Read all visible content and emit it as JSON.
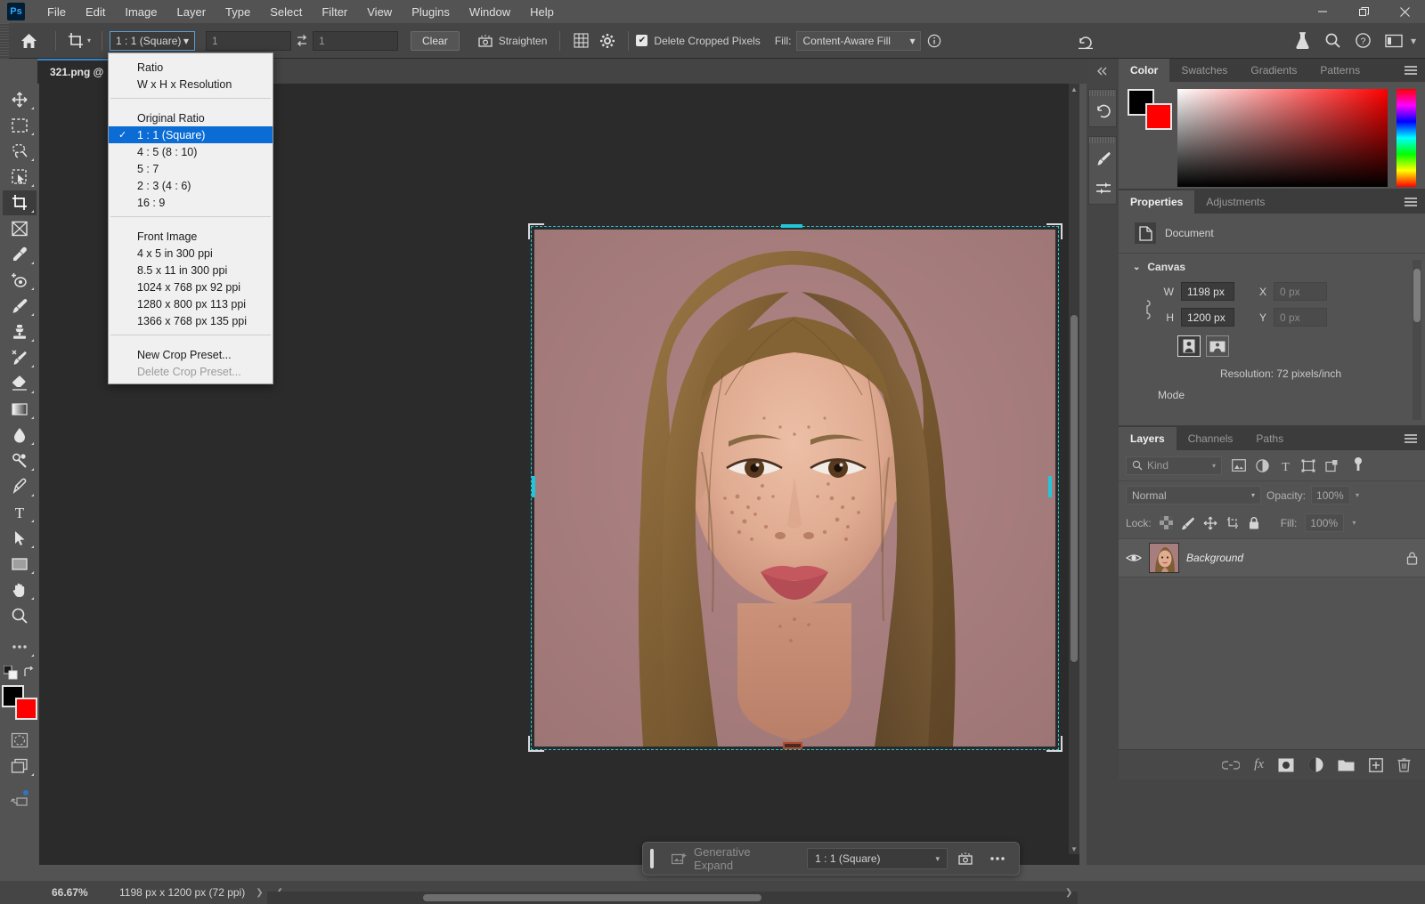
{
  "app": {
    "logo": "Ps",
    "title": "Adobe Photoshop"
  },
  "menubar": {
    "items": [
      "File",
      "Edit",
      "Image",
      "Layer",
      "Type",
      "Select",
      "Filter",
      "View",
      "Plugins",
      "Window",
      "Help"
    ]
  },
  "window_controls": {
    "minimize": "—",
    "maximize": "❐",
    "close": "✕"
  },
  "options_bar": {
    "home_icon": "home-icon",
    "tool_icon": "crop-tool-icon",
    "ratio_value": "1 : 1 (Square)",
    "width_value": "1",
    "height_value": "1",
    "swap_icon": "swap-width-height-icon",
    "clear_label": "Clear",
    "straighten_icon": "straighten-icon",
    "straighten_label": "Straighten",
    "overlay_icon": "grid-overlay-icon",
    "settings_icon": "gear-icon",
    "delete_cropped_label": "Delete Cropped Pixels",
    "delete_cropped_checked": true,
    "fill_label": "Fill:",
    "fill_value": "Content-Aware Fill",
    "info_icon": "info-icon",
    "reset_icon": "reset-icon",
    "flask_icon": "flask-icon",
    "search_icon": "search-icon",
    "help_icon": "help-icon",
    "workspace_icon": "workspace-icon"
  },
  "tabbar": {
    "expand_icon": "chevron-double-right-icon",
    "document_tab": "321.png @"
  },
  "crop_dropdown": {
    "groups": [
      {
        "items": [
          {
            "label": "Ratio",
            "selected": false,
            "disabled": false
          },
          {
            "label": "W x H x Resolution",
            "selected": false,
            "disabled": false
          }
        ]
      },
      {
        "items": [
          {
            "label": "Original Ratio",
            "selected": false,
            "disabled": false
          },
          {
            "label": "1 : 1 (Square)",
            "selected": true,
            "disabled": false
          },
          {
            "label": "4 : 5 (8 : 10)",
            "selected": false,
            "disabled": false
          },
          {
            "label": "5 : 7",
            "selected": false,
            "disabled": false
          },
          {
            "label": "2 : 3 (4 : 6)",
            "selected": false,
            "disabled": false
          },
          {
            "label": "16 : 9",
            "selected": false,
            "disabled": false
          }
        ]
      },
      {
        "items": [
          {
            "label": "Front Image",
            "selected": false,
            "disabled": false
          },
          {
            "label": "4 x 5 in 300 ppi",
            "selected": false,
            "disabled": false
          },
          {
            "label": "8.5 x 11 in 300 ppi",
            "selected": false,
            "disabled": false
          },
          {
            "label": "1024 x 768 px 92 ppi",
            "selected": false,
            "disabled": false
          },
          {
            "label": "1280 x 800 px 113 ppi",
            "selected": false,
            "disabled": false
          },
          {
            "label": "1366 x 768 px 135 ppi",
            "selected": false,
            "disabled": false
          }
        ]
      },
      {
        "items": [
          {
            "label": "New Crop Preset...",
            "selected": false,
            "disabled": false
          },
          {
            "label": "Delete Crop Preset...",
            "selected": false,
            "disabled": true
          }
        ]
      }
    ],
    "check_glyph": "✓",
    "highlight_color": "#0a6cd4"
  },
  "toolbar": {
    "tools": [
      {
        "name": "move-tool",
        "active": false
      },
      {
        "name": "marquee-tool",
        "active": false
      },
      {
        "name": "lasso-tool",
        "active": false
      },
      {
        "name": "object-selection-tool",
        "active": false
      },
      {
        "name": "crop-tool",
        "active": true
      },
      {
        "name": "frame-tool",
        "active": false
      },
      {
        "name": "eyedropper-tool",
        "active": false
      },
      {
        "name": "spot-healing-brush-tool",
        "active": false
      },
      {
        "name": "brush-tool",
        "active": false
      },
      {
        "name": "clone-stamp-tool",
        "active": false
      },
      {
        "name": "history-brush-tool",
        "active": false
      },
      {
        "name": "eraser-tool",
        "active": false
      },
      {
        "name": "gradient-tool",
        "active": false
      },
      {
        "name": "blur-tool",
        "active": false
      },
      {
        "name": "dodge-tool",
        "active": false
      },
      {
        "name": "pen-tool",
        "active": false
      },
      {
        "name": "type-tool",
        "active": false
      },
      {
        "name": "path-selection-tool",
        "active": false
      },
      {
        "name": "shape-tool",
        "active": false
      },
      {
        "name": "hand-tool",
        "active": false
      },
      {
        "name": "zoom-tool",
        "active": false
      },
      {
        "name": "edit-toolbar-tool",
        "active": false
      }
    ],
    "foreground_color": "#000000",
    "background_color": "#ff0000",
    "quickmask_icon": "quick-mask-icon",
    "screenmode_icon": "screen-mode-icon"
  },
  "canvas": {
    "background_color": "#2b2b2b",
    "photo_background": "#a87d7d",
    "crop_border_color": "#21c7d8",
    "alt_text": "portrait of a young person with freckles on a mauve background"
  },
  "contextual_taskbar": {
    "generative_expand_label": "Generative Expand",
    "generative_icon": "generative-expand-icon",
    "ratio_value": "1 : 1 (Square)",
    "straighten_icon": "straighten-icon",
    "more_icon": "more-options-icon"
  },
  "right_rail": {
    "collapse_icon": "chevron-double-right-icon",
    "buttons": [
      "history-icon",
      "brush-settings-icon",
      "adjustments-sliders-icon"
    ]
  },
  "color_panel": {
    "tabs": [
      {
        "label": "Color",
        "active": true
      },
      {
        "label": "Swatches",
        "active": false
      },
      {
        "label": "Gradients",
        "active": false
      },
      {
        "label": "Patterns",
        "active": false
      }
    ],
    "menu_icon": "panel-menu-icon",
    "foreground": "#000000",
    "background": "#ff0000"
  },
  "properties_panel": {
    "tabs": [
      {
        "label": "Properties",
        "active": true
      },
      {
        "label": "Adjustments",
        "active": false
      }
    ],
    "menu_icon": "panel-menu-icon",
    "document_label": "Document",
    "document_icon": "document-icon",
    "section_title": "Canvas",
    "collapse_icon": "chevron-down-icon",
    "link_icon": "link-dimensions-icon",
    "w_label": "W",
    "w_value": "1198 px",
    "h_label": "H",
    "h_value": "1200 px",
    "x_label": "X",
    "x_value": "0 px",
    "y_label": "Y",
    "y_value": "0 px",
    "portrait_icon": "portrait-orientation-icon",
    "landscape_icon": "landscape-orientation-icon",
    "resolution_text": "Resolution: 72 pixels/inch",
    "mode_label": "Mode"
  },
  "layers_panel": {
    "tabs": [
      {
        "label": "Layers",
        "active": true
      },
      {
        "label": "Channels",
        "active": false
      },
      {
        "label": "Paths",
        "active": false
      }
    ],
    "menu_icon": "panel-menu-icon",
    "filter_kind": "Kind",
    "filter_icons": [
      "filter-pixel-icon",
      "filter-adjustment-icon",
      "filter-type-icon",
      "filter-shape-icon",
      "filter-smart-icon"
    ],
    "filter_toggle_icon": "filter-toggle-icon",
    "blend_mode": "Normal",
    "opacity_label": "Opacity:",
    "opacity_value": "100%",
    "lock_label": "Lock:",
    "lock_icons": [
      "lock-transparency-icon",
      "lock-image-icon",
      "lock-position-icon",
      "lock-artboard-icon",
      "lock-all-icon"
    ],
    "fill_label": "Fill:",
    "fill_value": "100%",
    "layers": [
      {
        "name": "Background",
        "visible": true,
        "locked": true,
        "thumb_color": "#a87d7d"
      }
    ],
    "footer_icons": [
      "link-layers-icon",
      "fx-icon",
      "add-mask-icon",
      "new-adjustment-icon",
      "new-group-icon",
      "new-layer-icon",
      "delete-layer-icon"
    ],
    "fx_label": "fx"
  },
  "status_bar": {
    "zoom_level": "66.67%",
    "document_info": "1198 px x 1200 px (72 ppi)",
    "expand_icon": "chevron-right-icon",
    "prev_icon": "chevron-left-icon",
    "next_icon": "chevron-right-icon"
  }
}
